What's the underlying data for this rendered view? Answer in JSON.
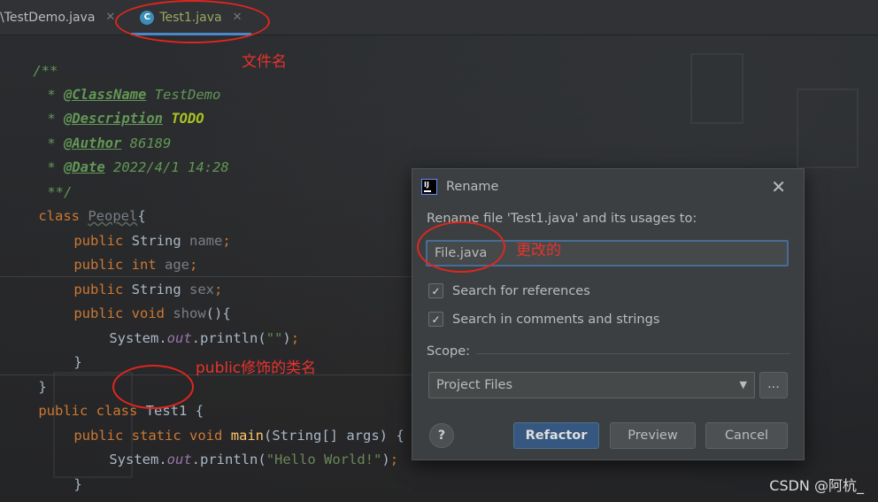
{
  "tabs": [
    {
      "label": "\\TestDemo.java",
      "active": false
    },
    {
      "label": "Test1.java",
      "active": true
    }
  ],
  "code": {
    "l1": "/**",
    "l2_tag": "@ClassName",
    "l2_val": " TestDemo",
    "l3_tag": "@Description",
    "l3_val": " TODO",
    "l4_tag": "@Author",
    "l4_val": " 86189",
    "l5_tag": "@Date",
    "l5_val": " 2022/4/1 14:28",
    "l6": "**/",
    "l7_kw": "class",
    "l7_name": "Peopel",
    "l7_brace": "{",
    "l8_kw": "public",
    "l8_type": "String",
    "l8_field": "name",
    "l9_kw": "public",
    "l9_type": "int",
    "l9_field": "age",
    "l10_kw": "public",
    "l10_type": "String",
    "l10_field": "sex",
    "l11_kw": "public",
    "l11_kw2": "void",
    "l11_name": "show",
    "l12_obj": "System",
    "l12_out": "out",
    "l12_call": "println",
    "l12_str": "\"\"",
    "brace_close": "}",
    "l15_kw": "public",
    "l15_kw2": "class",
    "l15_name": "Test1",
    "l15_brace": "{",
    "l16_kw": "public",
    "l16_kw2": "static",
    "l16_kw3": "void",
    "l16_name": "main",
    "l16_params": "(String[] args) {",
    "l17_obj": "System",
    "l17_out": "out",
    "l17_call": "println",
    "l17_str": "\"Hello World!\""
  },
  "annotations": {
    "filename": "文件名",
    "changed": "更改的",
    "public_class": "public修饰的类名"
  },
  "dialog": {
    "title": "Rename",
    "label": "Rename file 'Test1.java' and its usages to:",
    "input_value": "File.java",
    "checkbox1": "Search for references",
    "checkbox2": "Search in comments and strings",
    "scope_label": "Scope:",
    "scope_value": "Project Files",
    "dots": "...",
    "help": "?",
    "refactor": "Refactor",
    "preview": "Preview",
    "cancel": "Cancel"
  },
  "watermark": "CSDN @阿杭_"
}
